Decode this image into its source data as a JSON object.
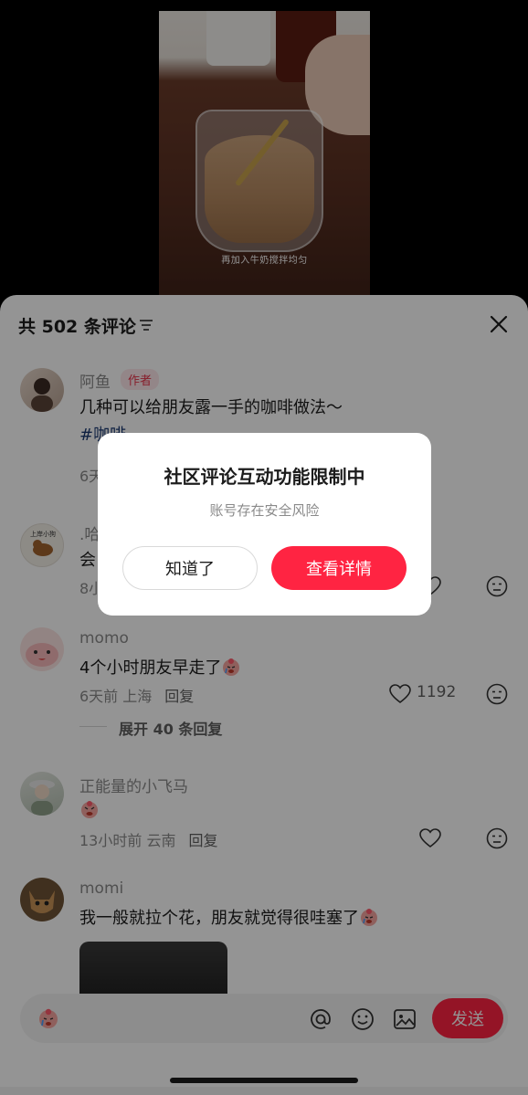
{
  "video": {
    "subtitle": "再加入牛奶搅拌均匀"
  },
  "header": {
    "comment_count": "共 502 条评论",
    "filter_icon": "filter-lines-icon",
    "close_icon": "close-x-icon"
  },
  "comments": [
    {
      "name": "阿鱼",
      "badge": "作者",
      "text": "几种可以给朋友露一手的咖啡做法～",
      "hashtag": "#咖啡",
      "meta": "6天",
      "avatar_color": "#d9c6b8"
    },
    {
      "name": ".哈",
      "avatar_caption": "上岸小狗",
      "text": "会",
      "meta": "8小",
      "avatar_color": "#f1ece3"
    },
    {
      "name": "momo",
      "text": "4个小时朋友早走了",
      "time_location": "6天前 上海",
      "reply_label": "回复",
      "like_count": "1192",
      "expand_label": "展开 40 条回复",
      "avatar_color": "#f6c7c8"
    },
    {
      "name": "正能量的小飞马",
      "time_location": "13小时前 云南",
      "reply_label": "回复",
      "avatar_color": "#cfd6cc"
    },
    {
      "name": "momi",
      "text": "我一般就拉个花，朋友就觉得很哇塞了",
      "avatar_color": "#8a6a44"
    }
  ],
  "input_bar": {
    "send_label": "发送",
    "icons": [
      "sad-emoji-icon",
      "at-icon",
      "smile-icon",
      "image-icon"
    ]
  },
  "dialog": {
    "title": "社区评论互动功能限制中",
    "message": "账号存在安全风险",
    "dismiss_label": "知道了",
    "details_label": "查看详情"
  },
  "colors": {
    "accent": "#ff2442",
    "hashtag": "#1b3a73",
    "muted_text": "#8a8a8a",
    "overlay": "rgba(0,0,0,0.42)"
  }
}
